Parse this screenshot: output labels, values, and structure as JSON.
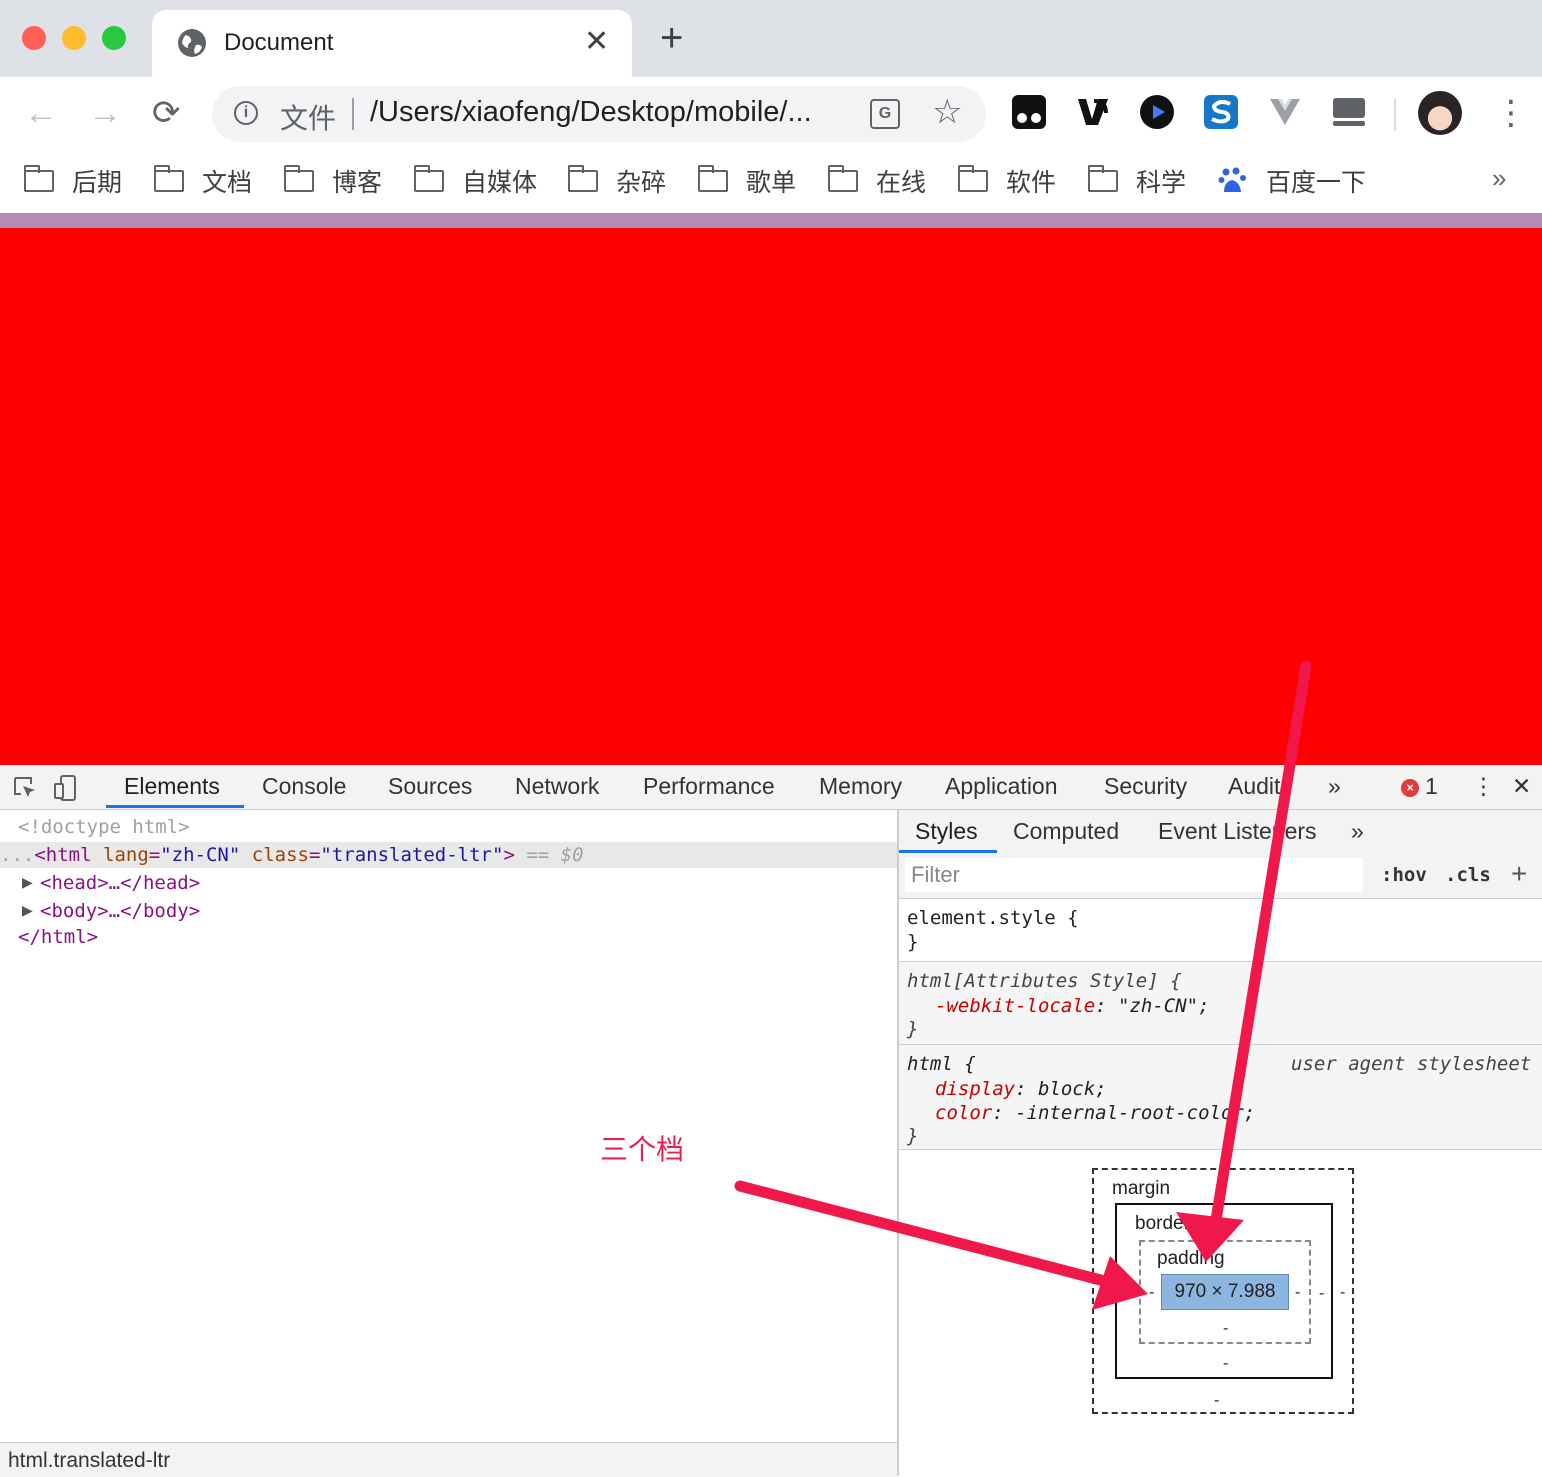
{
  "browser": {
    "tab": {
      "title": "Document",
      "close": "✕"
    },
    "new_tab": "+",
    "nav": {
      "back": "←",
      "forward": "→",
      "reload": "⟳"
    },
    "omnibox": {
      "info": "i",
      "scheme": "文件",
      "url": "/Users/xiaofeng/Desktop/mobile/...",
      "star": "☆",
      "translate": "G"
    },
    "menu": "⋮",
    "extensions": [
      "extension-1",
      "extension-2",
      "extension-3",
      "extension-4",
      "extension-5",
      "extension-6"
    ],
    "colors": {
      "tabstrip": "#dee1e6",
      "close": "#ff5f57",
      "minimize": "#febc2e",
      "maximize": "#28c840"
    }
  },
  "bookmarks": {
    "items": [
      "后期",
      "文档",
      "博客",
      "自媒体",
      "杂碎",
      "歌单",
      "在线",
      "软件",
      "科学"
    ],
    "baidu": "百度一下",
    "more": "»"
  },
  "page": {
    "background": "#ff0000"
  },
  "devtools": {
    "tabs": [
      "Elements",
      "Console",
      "Sources",
      "Network",
      "Performance",
      "Memory",
      "Application",
      "Security",
      "Audits"
    ],
    "more": "»",
    "errors": "1",
    "menu": "⋮",
    "close": "✕",
    "elements": {
      "doctype": "<!doctype html>",
      "html_open_prefix": "...",
      "html_tag": "html",
      "lang_attr": "lang",
      "lang_val": "\"zh-CN\"",
      "class_attr": "class",
      "class_val": "\"translated-ltr\"",
      "selected_marker": "== $0",
      "head": "<head>…</head>",
      "body": "<body>…</body>",
      "html_close": "</html>",
      "breadcrumb": "html.translated-ltr"
    },
    "styles": {
      "tabs": [
        "Styles",
        "Computed",
        "Event Listeners"
      ],
      "more": "»",
      "filter_placeholder": "Filter",
      "hov": ":hov",
      "cls": ".cls",
      "plus": "+",
      "rule1_selector": "element.style {",
      "rule1_close": "}",
      "rule2_selector": "html[Attributes Style] {",
      "rule2_prop": "-webkit-locale",
      "rule2_val": ": \"zh-CN\";",
      "rule2_close": "}",
      "rule3_selector": "html {",
      "rule3_source": "user agent stylesheet",
      "rule3_prop1": "display",
      "rule3_val1": ": block;",
      "rule3_prop2": "color",
      "rule3_val2": ": -internal-root-color;",
      "rule3_close": "}"
    },
    "box_model": {
      "margin": "margin",
      "border": "border",
      "padding": "padding",
      "content": "970 × 7.988",
      "dash": "-"
    }
  },
  "annotation": {
    "text": "三个档",
    "color": "#e8204f"
  }
}
